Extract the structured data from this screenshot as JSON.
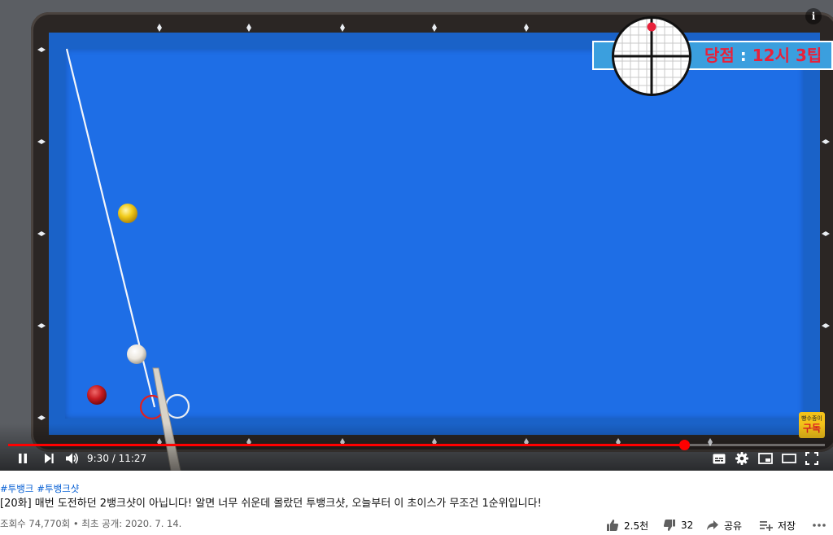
{
  "overlay": {
    "aim_label": "당점",
    "aim_sep": ":",
    "aim_value": "12시 3팁",
    "info_icon": "info-icon",
    "badge_top": "빵수종이",
    "badge_main": "구독"
  },
  "player": {
    "time_display": "9:30 / 11:27",
    "progress": 0.828,
    "icons": [
      "pause-icon",
      "next-icon",
      "volume-icon",
      "subtitles-icon",
      "settings-icon",
      "miniplayer-icon",
      "theater-icon",
      "fullscreen-icon"
    ]
  },
  "video": {
    "hashtags": [
      "#투뱅크",
      "#투뱅크샷"
    ],
    "title": "[20화] 매번 도전하던 2뱅크샷이 아닙니다! 알면 너무 쉬운데 몰랐던 투뱅크샷, 오늘부터 이 초이스가 무조건 1순위입니다!",
    "meta": "조회수 74,770회 • 최초 공개: 2020. 7. 14."
  },
  "actions": {
    "like_count": "2.5천",
    "dislike_count": "32",
    "share_label": "공유",
    "save_label": "저장"
  },
  "colors": {
    "cloth": "#1e6ee6",
    "progress": "#ff0000",
    "link": "#065fd4",
    "aim_text": "#e8213a"
  }
}
